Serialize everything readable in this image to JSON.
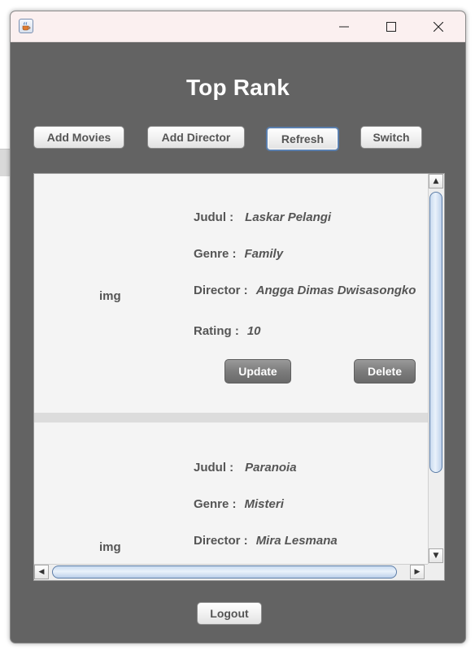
{
  "window": {
    "icon": "java-cup-icon",
    "controls": {
      "minimize": "minimize-icon",
      "maximize": "maximize-icon",
      "close": "close-icon"
    }
  },
  "header": {
    "title": "Top Rank"
  },
  "toolbar": {
    "add_movies": "Add Movies",
    "add_director": "Add Director",
    "refresh": "Refresh",
    "switch": "Switch"
  },
  "movies": [
    {
      "image_placeholder": "img",
      "judul_label": "Judul :",
      "judul": "Laskar Pelangi",
      "genre_label": "Genre :",
      "genre": "Family",
      "director_label": "Director :",
      "director": "Angga Dimas Dwisasongko",
      "rating_label": "Rating :",
      "rating": "10",
      "update_label": "Update",
      "delete_label": "Delete"
    },
    {
      "image_placeholder": "img",
      "judul_label": "Judul :",
      "judul": "Paranoia",
      "genre_label": "Genre :",
      "genre": "Misteri",
      "director_label": "Director :",
      "director": "Mira Lesmana"
    }
  ],
  "footer": {
    "logout": "Logout"
  },
  "colors": {
    "window_bg": "#636363",
    "title_bar": "#fbf0f0",
    "panel_bg": "#f4f4f4",
    "scroll_thumb": "#c9dbf0"
  }
}
